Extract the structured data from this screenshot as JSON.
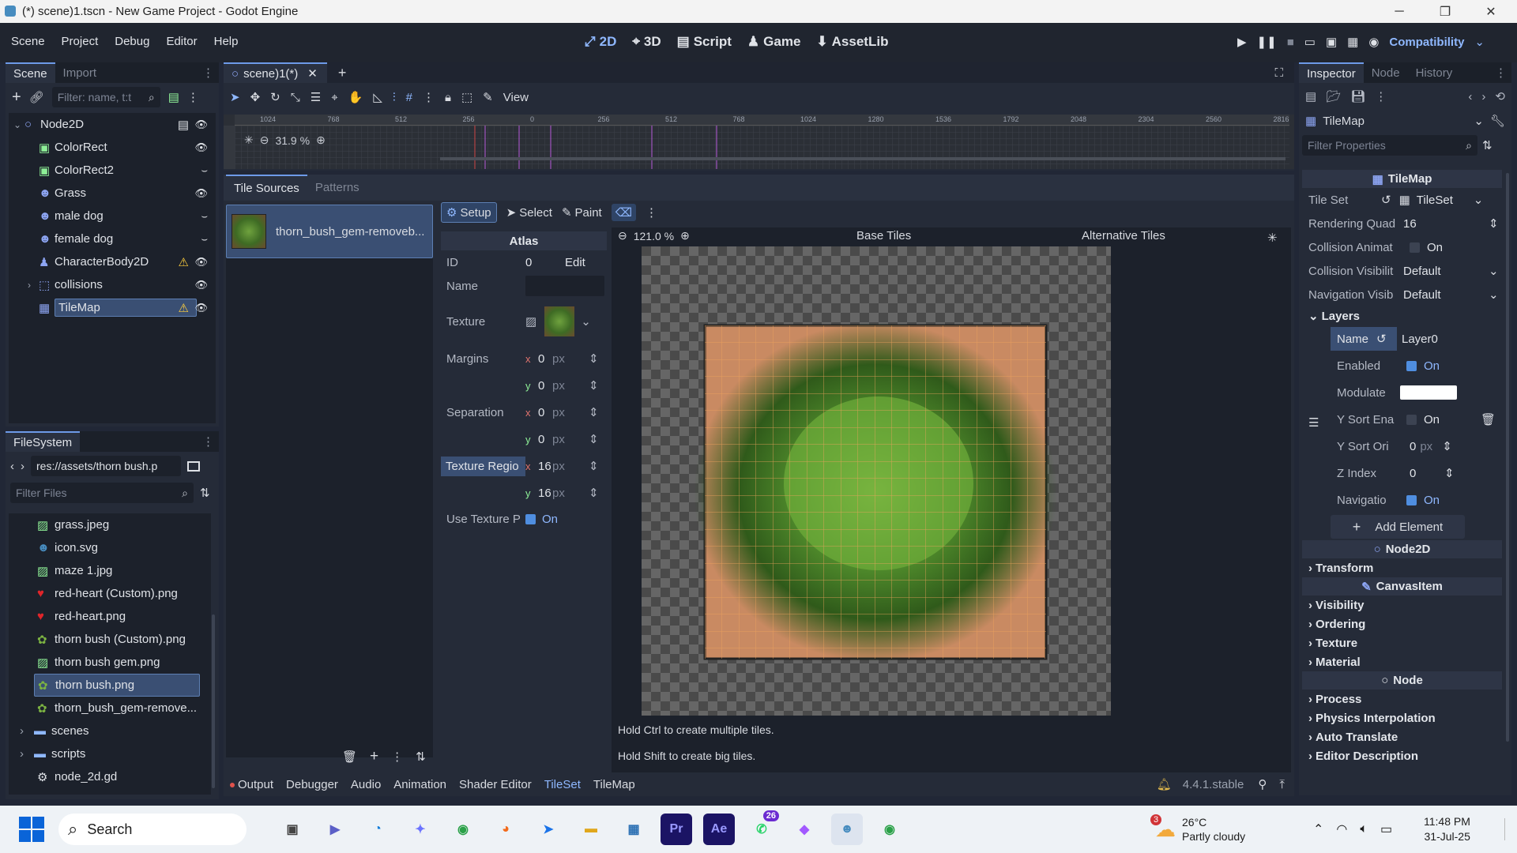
{
  "window": {
    "title": "(*) scene)1.tscn - New Game Project - Godot Engine",
    "minimize": "─",
    "maximize": "❐",
    "close": "✕"
  },
  "menu": {
    "items": [
      "Scene",
      "Project",
      "Debug",
      "Editor",
      "Help"
    ]
  },
  "workspaces": {
    "w2d": "2D",
    "w3d": "3D",
    "script": "Script",
    "game": "Game",
    "assetlib": "AssetLib"
  },
  "renderer": "Compatibility",
  "scene_dock": {
    "tabs": [
      "Scene",
      "Import"
    ],
    "filter_placeholder": "Filter: name, t:t",
    "nodes": [
      {
        "label": "Node2D",
        "icon": "node2d-icon",
        "color": "#8da5f3"
      },
      {
        "label": "ColorRect",
        "icon": "colorrect-icon",
        "color": "#8eef97"
      },
      {
        "label": "ColorRect2",
        "icon": "colorrect-icon",
        "color": "#8eef97"
      },
      {
        "label": "Grass",
        "icon": "sprite-icon",
        "color": "#8da5f3"
      },
      {
        "label": "male dog",
        "icon": "sprite-icon",
        "color": "#8da5f3"
      },
      {
        "label": "female dog",
        "icon": "sprite-icon",
        "color": "#8da5f3"
      },
      {
        "label": "CharacterBody2D",
        "icon": "characterbody-icon",
        "color": "#8da5f3"
      },
      {
        "label": "collisions",
        "icon": "node-icon",
        "color": "#8da5f3"
      },
      {
        "label": "TileMap",
        "icon": "tilemap-icon",
        "color": "#8da5f3"
      }
    ]
  },
  "filesystem": {
    "title": "FileSystem",
    "path": "res://assets/thorn bush.p",
    "filter_placeholder": "Filter Files",
    "files": [
      {
        "label": "grass.jpeg",
        "icon": "image-icon"
      },
      {
        "label": "icon.svg",
        "icon": "godot-icon"
      },
      {
        "label": "maze 1.jpg",
        "icon": "image-icon"
      },
      {
        "label": "red-heart (Custom).png",
        "icon": "heart-icon"
      },
      {
        "label": "red-heart.png",
        "icon": "heart-icon"
      },
      {
        "label": "thorn bush (Custom).png",
        "icon": "bush-icon"
      },
      {
        "label": "thorn bush gem.png",
        "icon": "image-icon"
      },
      {
        "label": "thorn bush.png",
        "icon": "bush-icon"
      },
      {
        "label": "thorn_bush_gem-remove...",
        "icon": "bush-icon"
      },
      {
        "label": "scenes",
        "icon": "folder-icon"
      },
      {
        "label": "scripts",
        "icon": "folder-icon"
      },
      {
        "label": "node_2d.gd",
        "icon": "gear-icon"
      }
    ]
  },
  "editor": {
    "scene_tab": "scene)1(*)",
    "view_label": "View",
    "zoom": "31.9 %",
    "ruler_ticks": [
      "1024",
      "768",
      "512",
      "256",
      "0",
      "256",
      "512",
      "768",
      "1024",
      "1280",
      "1536",
      "1792",
      "2048",
      "2304",
      "2560",
      "2816"
    ]
  },
  "tileset": {
    "tabs": [
      "Tile Sources",
      "Patterns"
    ],
    "source_name": "thorn_bush_gem-removeb...",
    "modes": {
      "setup": "Setup",
      "select": "Select",
      "paint": "Paint"
    },
    "atlas": {
      "title": "Atlas",
      "id_label": "ID",
      "id_value": "0",
      "edit_label": "Edit",
      "name_label": "Name",
      "texture_label": "Texture",
      "margins_label": "Margins",
      "separation_label": "Separation",
      "region_label": "Texture Regio",
      "use_texture_label": "Use Texture P",
      "on_label": "On",
      "margins": {
        "x": "0",
        "y": "0"
      },
      "separation": {
        "x": "0",
        "y": "0"
      },
      "region": {
        "x": "16",
        "y": "16"
      },
      "axis_x": "x",
      "axis_y": "y",
      "unit": "px"
    },
    "view": {
      "zoom": "121.0 %",
      "base_tiles": "Base Tiles",
      "alt_tiles": "Alternative Tiles",
      "hint1": "Hold Ctrl to create multiple tiles.",
      "hint2": "Hold Shift to create big tiles."
    }
  },
  "bottom_bar": {
    "tabs": [
      "Output",
      "Debugger",
      "Audio",
      "Animation",
      "Shader Editor",
      "TileSet",
      "TileMap"
    ],
    "version": "4.4.1.stable"
  },
  "inspector": {
    "tabs": [
      "Inspector",
      "Node",
      "History"
    ],
    "object": "TileMap",
    "filter_placeholder": "Filter Properties",
    "class_title": "TileMap",
    "props": {
      "tile_set": {
        "label": "Tile Set",
        "value": "TileSet"
      },
      "rendering_quadrant": {
        "label": "Rendering Quad",
        "value": "16"
      },
      "collision_anim": {
        "label": "Collision Animat",
        "value": "On"
      },
      "collision_vis": {
        "label": "Collision Visibilit",
        "value": "Default"
      },
      "nav_vis": {
        "label": "Navigation Visib",
        "value": "Default"
      }
    },
    "layers": {
      "title": "Layers",
      "name": {
        "label": "Name",
        "value": "Layer0"
      },
      "enabled": {
        "label": "Enabled",
        "value": "On"
      },
      "modulate": {
        "label": "Modulate"
      },
      "ysort_enabled": {
        "label": "Y Sort Ena",
        "value": "On"
      },
      "ysort_origin": {
        "label": "Y Sort Ori",
        "value": "0",
        "unit": "px"
      },
      "z_index": {
        "label": "Z Index",
        "value": "0"
      },
      "navigation": {
        "label": "Navigatio",
        "value": "On"
      },
      "add": "Add Element"
    },
    "node2d_title": "Node2D",
    "transform": "Transform",
    "canvasitem_title": "CanvasItem",
    "canvas_sections": [
      "Visibility",
      "Ordering",
      "Texture",
      "Material"
    ],
    "node_title": "Node",
    "node_sections": [
      "Process",
      "Physics Interpolation",
      "Auto Translate",
      "Editor Description"
    ]
  },
  "taskbar": {
    "search": "Search",
    "weather_temp": "26°C",
    "weather_desc": "Partly cloudy",
    "weather_badge": "3",
    "whatsapp_badge": "26",
    "time": "11:48 PM",
    "date": "31-Jul-25"
  },
  "colors": {
    "accent": "#6d9ae8",
    "warning": "#ffcf3d",
    "selection": "#3a4f73",
    "tile_grid": "#f0a35c"
  }
}
